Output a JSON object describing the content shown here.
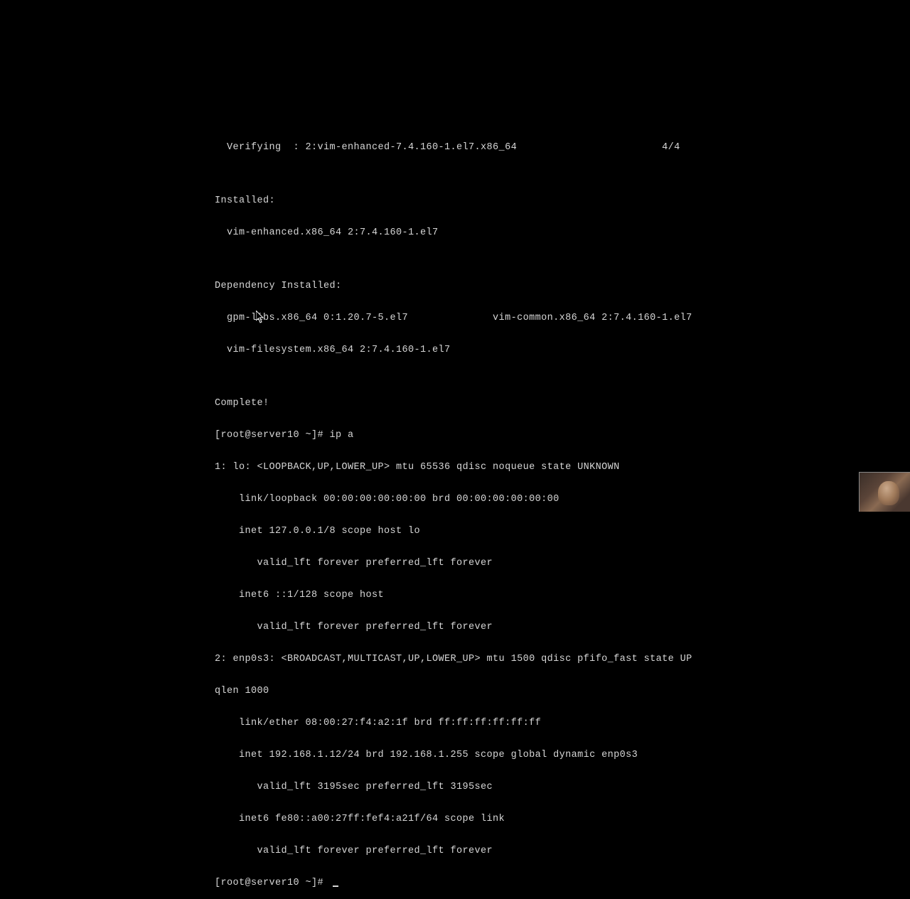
{
  "terminal": {
    "lines": [
      "  Verifying  : 2:vim-enhanced-7.4.160-1.el7.x86_64                        4/4",
      "",
      "Installed:",
      "  vim-enhanced.x86_64 2:7.4.160-1.el7",
      "",
      "Dependency Installed:",
      "  gpm-libs.x86_64 0:1.20.7-5.el7              vim-common.x86_64 2:7.4.160-1.el7",
      "  vim-filesystem.x86_64 2:7.4.160-1.el7",
      "",
      "Complete!",
      "[root@server10 ~]# ip a",
      "1: lo: <LOOPBACK,UP,LOWER_UP> mtu 65536 qdisc noqueue state UNKNOWN",
      "    link/loopback 00:00:00:00:00:00 brd 00:00:00:00:00:00",
      "    inet 127.0.0.1/8 scope host lo",
      "       valid_lft forever preferred_lft forever",
      "    inet6 ::1/128 scope host",
      "       valid_lft forever preferred_lft forever",
      "2: enp0s3: <BROADCAST,MULTICAST,UP,LOWER_UP> mtu 1500 qdisc pfifo_fast state UP ",
      "qlen 1000",
      "    link/ether 08:00:27:f4:a2:1f brd ff:ff:ff:ff:ff:ff",
      "    inet 192.168.1.12/24 brd 192.168.1.255 scope global dynamic enp0s3",
      "       valid_lft 3195sec preferred_lft 3195sec",
      "    inet6 fe80::a00:27ff:fef4:a21f/64 scope link",
      "       valid_lft forever preferred_lft forever"
    ],
    "prompt": "[root@server10 ~]# "
  }
}
